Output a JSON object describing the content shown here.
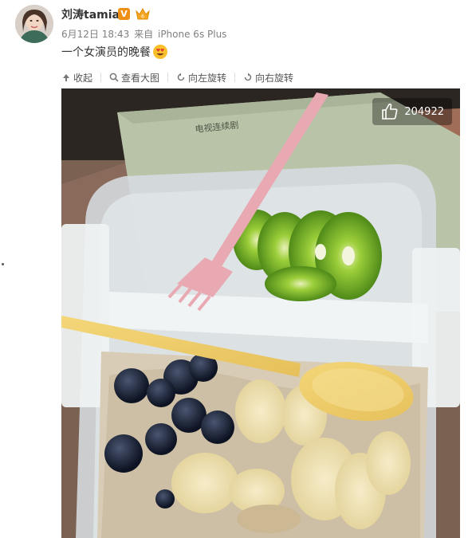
{
  "user": {
    "name": "刘涛tamia",
    "verified_label": "V"
  },
  "post": {
    "date": "6月12日 18:43",
    "source_prefix": "来自",
    "device": "iPhone 6s Plus",
    "text": "一个女演员的晚餐"
  },
  "toolbar": {
    "collapse": "收起",
    "view_large": "查看大图",
    "rotate_left": "向左旋转",
    "rotate_right": "向右旋转"
  },
  "photo": {
    "likes": "204922",
    "notebook_text": "电视连续剧"
  },
  "colors": {
    "accent_orange": "#f08f16",
    "meta_gray": "#808080"
  }
}
